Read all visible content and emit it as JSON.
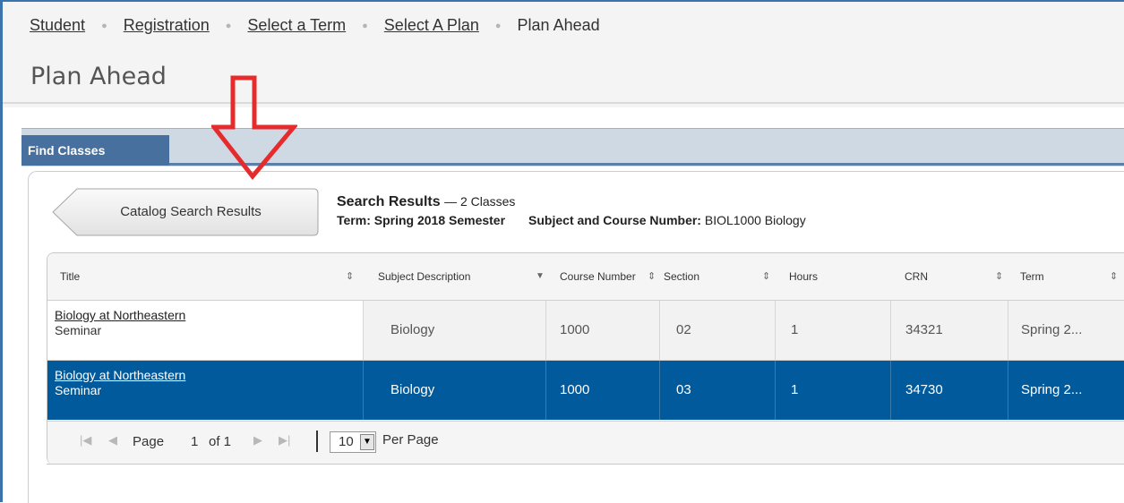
{
  "breadcrumb": {
    "items": [
      "Student",
      "Registration",
      "Select a Term",
      "Select A Plan"
    ],
    "current": "Plan Ahead"
  },
  "page": {
    "title": "Plan Ahead"
  },
  "tabs": {
    "find_classes": "Find Classes"
  },
  "back_button": {
    "label": "Catalog Search Results"
  },
  "results": {
    "title": "Search Results",
    "count": "— 2 Classes",
    "term_label": "Term:",
    "term_value": "Spring 2018 Semester",
    "subject_label": "Subject and Course Number:",
    "subject_value": "BIOL1000 Biology"
  },
  "table": {
    "columns": [
      "Title",
      "Subject Description",
      "Course Number",
      "Section",
      "Hours",
      "CRN",
      "Term"
    ],
    "rows": [
      {
        "title": "Biology at Northeastern",
        "type": "Seminar",
        "subject": "Biology",
        "course": "1000",
        "section": "02",
        "hours": "1",
        "crn": "34321",
        "term": "Spring 2..."
      },
      {
        "title": "Biology at Northeastern",
        "type": "Seminar",
        "subject": "Biology",
        "course": "1000",
        "section": "03",
        "hours": "1",
        "crn": "34730",
        "term": "Spring 2...",
        "selected": true
      }
    ]
  },
  "pager": {
    "page_label": "Page",
    "page_number": "1",
    "of_label": "of  1",
    "per_page_value": "10",
    "per_page_label": "Per Page"
  },
  "colors": {
    "selected_row": "#005a9c",
    "tab": "#47709e",
    "annotation_arrow": "#e52b2b"
  },
  "icons": [
    "first-page-icon",
    "prev-page-icon",
    "next-page-icon",
    "last-page-icon",
    "sort-icon",
    "dropdown-icon",
    "down-arrow-annotation"
  ]
}
